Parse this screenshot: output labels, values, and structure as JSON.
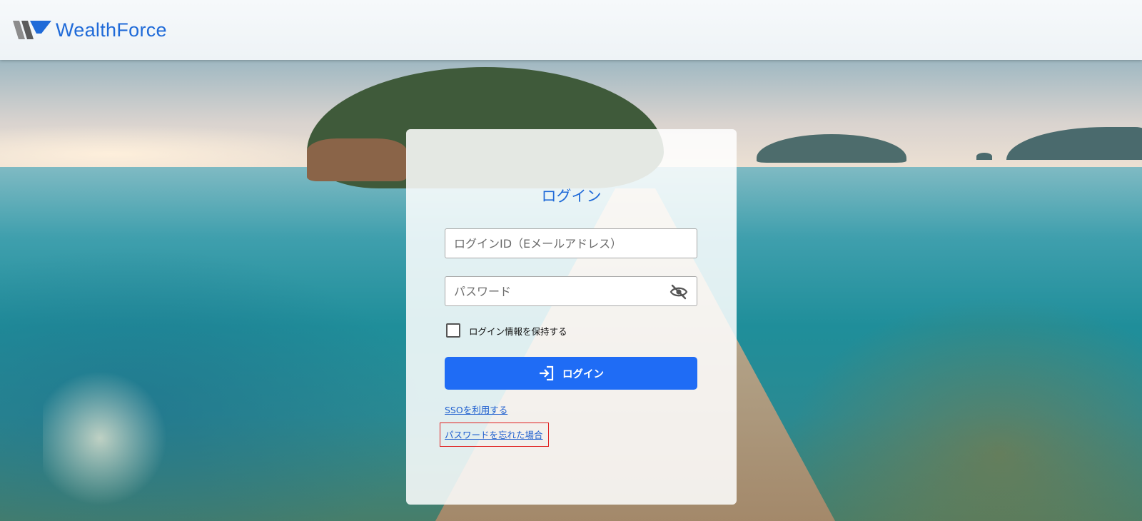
{
  "header": {
    "brand_part1": "Wealth",
    "brand_part2": "Force"
  },
  "login": {
    "title": "ログイン",
    "id_placeholder": "ログインID（Eメールアドレス）",
    "password_placeholder": "パスワード",
    "remember_label": "ログイン情報を保持する",
    "submit_label": "ログイン",
    "sso_link": "SSOを利用する",
    "forgot_link": "パスワードを忘れた場合"
  },
  "icons": {
    "logo": "wealthforce-logo-icon",
    "password_visibility": "eye-off-icon",
    "login_button": "login-arrow-icon"
  },
  "colors": {
    "brand": "#1f6ad8",
    "primary_button": "#1f6cf5",
    "highlight": "#e02020"
  }
}
